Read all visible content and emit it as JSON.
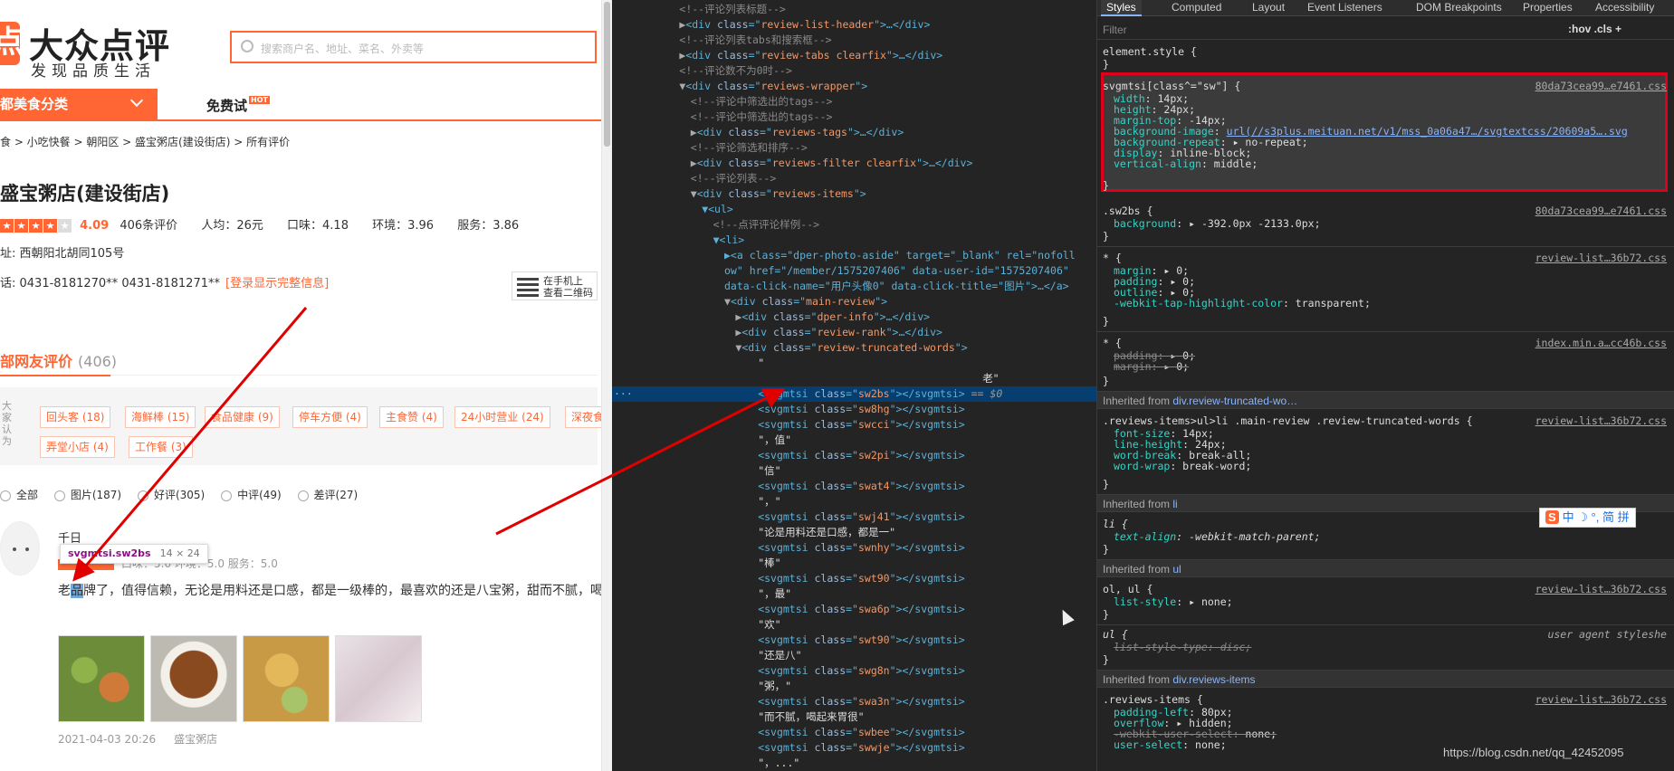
{
  "page": {
    "logo_text": "大众点评",
    "slogan": "发现品质生活",
    "search_placeholder": "搜索商户名、地址、菜名、外卖等",
    "nav_category": "都美食分类",
    "nav_free": "免费试",
    "nav_free_badge": "HOT",
    "breadcrumb": "食 > 小吃快餐 > 朝阳区 > 盛宝粥店(建设街店) > 所有评价",
    "shop_name": "盛宝粥店(建设街店)",
    "rating": {
      "score": "4.09",
      "reviews": "406条评价",
      "price": "人均：26元",
      "taste": "口味：4.18",
      "env": "环境：3.96",
      "service": "服务：3.86"
    },
    "address": "址: 西朝阳北胡同105号",
    "phone": "话: 0431-8181270** 0431-8181271**",
    "phone_login": "[登录显示完整信息]",
    "qr_line1": "在手机上",
    "qr_line2": "查看二维码",
    "reviews_title": "部网友评价",
    "reviews_count": "(406)",
    "tags_side": "大家认为",
    "tags": [
      "回头客 (18)",
      "海鲜棒 (15)",
      "食品健康 (9)",
      "停车方便 (4)",
      "主食赞 (4)",
      "24小时营业 (24)",
      "深夜食",
      "弄堂小店 (4)",
      "工作餐 (3)"
    ],
    "filters": [
      "全部",
      "图片(187)",
      "好评(305)",
      "中评(49)",
      "差评(27)"
    ],
    "username": "千日",
    "review_rank": "口味：5.0  环境：5.0  服务：5.0",
    "review_text_pre": "老",
    "review_text_hl": "品",
    "review_text_post": "牌了，值得信赖，无论是用料还是口感，都是一级棒的，最喜欢的还是八宝粥，甜而不腻，喝",
    "tooltip_name": "svgmtsi.sw2bs",
    "tooltip_size": "14 × 24",
    "review_date": "2021-04-03 20:26",
    "review_shop": "盛宝粥店"
  },
  "elements": [
    {
      "t": "cmt",
      "indent": 6,
      "text": "<!--评论列表标题-->"
    },
    {
      "t": "node",
      "indent": 6,
      "arrow": "▶",
      "tag": "div",
      "cls": "review-list-header",
      "tail": ">…</div>"
    },
    {
      "t": "cmt",
      "indent": 6,
      "text": "<!--评论列表tabs和搜索框-->"
    },
    {
      "t": "node",
      "indent": 6,
      "arrow": "▶",
      "tag": "div",
      "cls": "review-tabs clearfix",
      "tail": ">…</div>"
    },
    {
      "t": "cmt",
      "indent": 6,
      "text": "<!--评论数不为0时-->"
    },
    {
      "t": "node",
      "indent": 6,
      "arrow": "▼",
      "tag": "div",
      "cls": "reviews-wrapper",
      "tail": ">"
    },
    {
      "t": "cmt",
      "indent": 7,
      "text": "<!--评论中筛选出的tags-->"
    },
    {
      "t": "cmt",
      "indent": 7,
      "text": "<!--评论中筛选出的tags-->"
    },
    {
      "t": "node",
      "indent": 7,
      "arrow": "▶",
      "tag": "div",
      "cls": "reviews-tags",
      "tail": ">…</div>"
    },
    {
      "t": "cmt",
      "indent": 7,
      "text": "<!--评论筛选和排序-->"
    },
    {
      "t": "node",
      "indent": 7,
      "arrow": "▶",
      "tag": "div",
      "cls": "reviews-filter clearfix",
      "tail": ">…</div>"
    },
    {
      "t": "cmt",
      "indent": 7,
      "text": "<!--评论列表-->"
    },
    {
      "t": "node",
      "indent": 7,
      "arrow": "▼",
      "tag": "div",
      "cls": "reviews-items",
      "tail": ">"
    },
    {
      "t": "raw",
      "indent": 8,
      "text": "▼<ul>"
    },
    {
      "t": "cmt",
      "indent": 9,
      "text": "<!--点评评论样例-->"
    },
    {
      "t": "raw",
      "indent": 9,
      "text": "▼<li>"
    },
    {
      "t": "raw",
      "indent": 10,
      "text": "▶<a class=\"dper-photo-aside\" target=\"_blank\" rel=\"nofoll"
    },
    {
      "t": "raw",
      "indent": 10,
      "text": "ow\" href=\"/member/1575207406\" data-user-id=\"1575207406\""
    },
    {
      "t": "raw",
      "indent": 10,
      "text": "data-click-name=\"用户头像0\" data-click-title=\"图片\">…</a>"
    },
    {
      "t": "node",
      "indent": 10,
      "arrow": "▼",
      "tag": "div",
      "cls": "main-review",
      "tail": ">"
    },
    {
      "t": "node",
      "indent": 11,
      "arrow": "▶",
      "tag": "div",
      "cls": "dper-info",
      "tail": ">…</div>"
    },
    {
      "t": "node",
      "indent": 11,
      "arrow": "▶",
      "tag": "div",
      "cls": "review-rank",
      "tail": ">…</div>"
    },
    {
      "t": "node",
      "indent": 11,
      "arrow": "▼",
      "tag": "div",
      "cls": "review-truncated-words",
      "tail": ">"
    },
    {
      "t": "txt",
      "indent": 13,
      "text": "\""
    },
    {
      "t": "txt",
      "indent": 33,
      "text": "老\""
    },
    {
      "t": "svg",
      "indent": 13,
      "cls": "sw2bs",
      "sel": true
    },
    {
      "t": "svg",
      "indent": 13,
      "cls": "sw8hg"
    },
    {
      "t": "svg",
      "indent": 13,
      "cls": "swcci"
    },
    {
      "t": "txt",
      "indent": 13,
      "text": "\"，值\""
    },
    {
      "t": "svg",
      "indent": 13,
      "cls": "sw2pi"
    },
    {
      "t": "txt",
      "indent": 13,
      "text": "\"信\""
    },
    {
      "t": "svg",
      "indent": 13,
      "cls": "swat4"
    },
    {
      "t": "txt",
      "indent": 13,
      "text": "\"，\""
    },
    {
      "t": "svg",
      "indent": 13,
      "cls": "swj41"
    },
    {
      "t": "txt",
      "indent": 13,
      "text": "\"论是用料还是口感，都是一\""
    },
    {
      "t": "svg",
      "indent": 13,
      "cls": "swnhy"
    },
    {
      "t": "txt",
      "indent": 13,
      "text": "\"棒\""
    },
    {
      "t": "svg",
      "indent": 13,
      "cls": "swt90"
    },
    {
      "t": "txt",
      "indent": 13,
      "text": "\"，最\""
    },
    {
      "t": "svg",
      "indent": 13,
      "cls": "swa6p"
    },
    {
      "t": "txt",
      "indent": 13,
      "text": "\"欢\""
    },
    {
      "t": "svg",
      "indent": 13,
      "cls": "swt90"
    },
    {
      "t": "txt",
      "indent": 13,
      "text": "\"还是八\""
    },
    {
      "t": "svg",
      "indent": 13,
      "cls": "swg8n"
    },
    {
      "t": "txt",
      "indent": 13,
      "text": "\"粥，\""
    },
    {
      "t": "svg",
      "indent": 13,
      "cls": "swa3n"
    },
    {
      "t": "txt",
      "indent": 13,
      "text": "\"而不腻，喝起来胃很\""
    },
    {
      "t": "svg",
      "indent": 13,
      "cls": "swbee"
    },
    {
      "t": "svg",
      "indent": 13,
      "cls": "swwje"
    },
    {
      "t": "txt",
      "indent": 13,
      "text": "\"，...\""
    }
  ],
  "selected_suffix": " == $0",
  "styles": {
    "tabs": [
      "Styles",
      "Computed",
      "Layout",
      "Event Listeners",
      "DOM Breakpoints",
      "Properties",
      "Accessibility"
    ],
    "filter_placeholder": "Filter",
    "filter_right": ":hov  .cls  +",
    "element_style": "element.style {",
    "rule1_selector": "svgmtsi[class^=\"sw\"] {",
    "rule1_source": "80da73cea99…e7461.css",
    "rule1_props": [
      [
        "width",
        "14px;"
      ],
      [
        "height",
        "24px;"
      ],
      [
        "margin-top",
        "-14px;"
      ],
      [
        "background-image",
        "url(//s3plus.meituan.net/v1/mss_0a06a47…/svgtextcss/20609a5….svg"
      ],
      [
        "background-repeat",
        "▸ no-repeat;"
      ],
      [
        "display",
        "inline-block;"
      ],
      [
        "vertical-align",
        "middle;"
      ]
    ],
    "rule2_selector": ".sw2bs {",
    "rule2_source": "80da73cea99…e7461.css",
    "rule2_prop": [
      "background",
      "▸ -392.0px -2133.0px;"
    ],
    "rule3_source": "review-list…36b72.css",
    "rule3_props": [
      [
        "margin",
        "▸ 0;"
      ],
      [
        "padding",
        "▸ 0;"
      ],
      [
        "outline",
        "▸ 0;"
      ],
      [
        "-webkit-tap-highlight-color",
        "transparent;"
      ]
    ],
    "rule4_source": "index.min.a…cc46b.css",
    "rule4_props": [
      [
        "padding",
        "▸ 0;"
      ],
      [
        "margin",
        "▸ 0;"
      ]
    ],
    "inh1_prefix": "Inherited from ",
    "inh1": "div.review-truncated-wo…",
    "rule5_selector": ".reviews-items>ul>li .main-review .review-truncated-words {",
    "rule5_source": "review-list…36b72.css",
    "rule5_props": [
      [
        "font-size",
        "14px;"
      ],
      [
        "line-height",
        "24px;"
      ],
      [
        "word-break",
        "break-all;"
      ],
      [
        "word-wrap",
        "break-word;"
      ]
    ],
    "inh2": "li",
    "rule6_prop": [
      "text-align",
      "-webkit-match-parent;"
    ],
    "inh3": "ul",
    "rule7_selector": "ol, ul {",
    "rule7_source": "review-list…36b72.css",
    "rule7_prop": [
      "list-style",
      "▸ none;"
    ],
    "rule8_source": "user agent styleshe",
    "rule8_prop": [
      "list-style-type",
      "disc;"
    ],
    "inh4": "div.reviews-items",
    "rule9_selector": ".reviews-items {",
    "rule9_source": "review-list…36b72.css",
    "rule9_props": [
      [
        "padding-left",
        "80px;"
      ],
      [
        "overflow",
        "▸ hidden;"
      ],
      [
        "-webkit-user-select",
        "none;"
      ],
      [
        "user-select",
        "none;"
      ]
    ]
  },
  "ime_text": "中 ☽ °, 简 拼",
  "ime_logo": "S",
  "watermark": "https://blog.csdn.net/qq_42452095"
}
